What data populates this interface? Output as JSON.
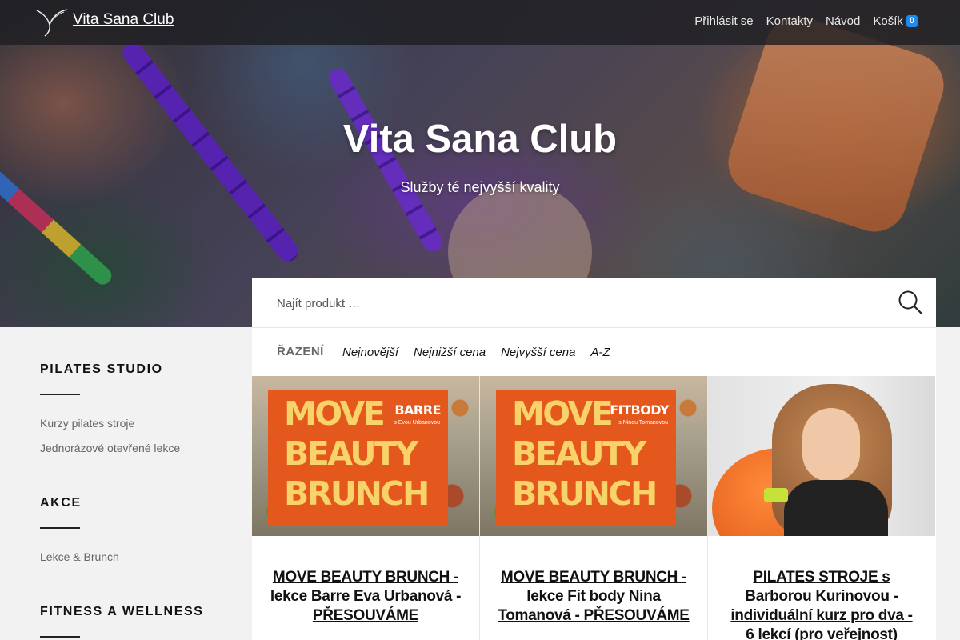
{
  "brand": {
    "name": "Vita Sana Club"
  },
  "nav": {
    "items": [
      "Přihlásit se",
      "Kontakty",
      "Návod"
    ],
    "cart_label": "Košík",
    "cart_count": "0"
  },
  "hero": {
    "title": "Vita Sana Club",
    "subtitle": "Služby té nejvyšší kvality"
  },
  "sidebar": {
    "sections": [
      {
        "title": "PILATES STUDIO",
        "links": [
          "Kurzy pilates stroje",
          "Jednorázové otevřené lekce"
        ]
      },
      {
        "title": "AKCE",
        "links": [
          "Lekce & Brunch"
        ]
      },
      {
        "title": "FITNESS A WELLNESS",
        "links": []
      }
    ]
  },
  "search": {
    "placeholder": "Najít produkt …"
  },
  "sort": {
    "label": "ŘAZENÍ",
    "options": [
      "Nejnovější",
      "Nejnižší cena",
      "Nejvyšší cena",
      "A-Z"
    ]
  },
  "products": [
    {
      "name": "MOVE BEAUTY BRUNCH - lekce Barre Eva Urbanová - PŘESOUVÁME",
      "image": {
        "lines": [
          "MOVE",
          "BEAUTY",
          "BRUNCH"
        ],
        "tag": "BARRE",
        "small": "s Evou Urbanovou"
      }
    },
    {
      "name": "MOVE BEAUTY BRUNCH - lekce Fit body Nina Tomanová - PŘESOUVÁME",
      "image": {
        "lines": [
          "MOVE",
          "BEAUTY",
          "BRUNCH"
        ],
        "tag": "FITBODY",
        "small": "s Ninou Tomanovou"
      }
    },
    {
      "name": "PILATES STROJE s Barborou Kurinovou - individuální kurz pro dva - 6 lekcí (pro veřejnost)"
    }
  ],
  "colors": {
    "accent": "#1c8bf0",
    "promo_orange": "#e4571d",
    "promo_yellow": "#f7d36a"
  }
}
